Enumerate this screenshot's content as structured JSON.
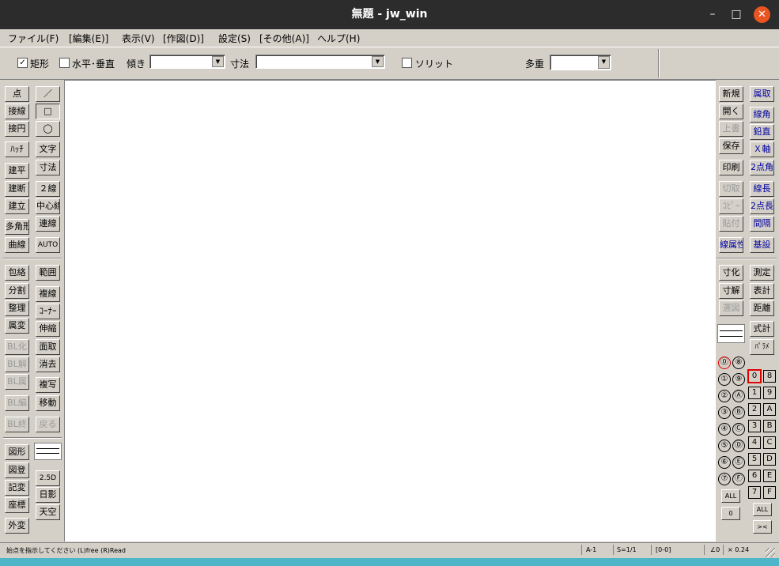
{
  "window": {
    "title": "無題 - jw_win",
    "controls": {
      "minimize": "–",
      "maximize": "□",
      "close": "✕"
    }
  },
  "menu": [
    {
      "label": "ファイル(F)"
    },
    {
      "label": "[編集(E)]"
    },
    {
      "label": "表示(V)"
    },
    {
      "label": "[作図(D)]"
    },
    {
      "label": "設定(S)"
    },
    {
      "label": "[その他(A)]"
    },
    {
      "label": "ヘルプ(H)"
    }
  ],
  "toolbar": {
    "rect_check": "✓",
    "rect_label": "矩形",
    "hv_label": "水平･垂直",
    "slope_label": "傾き",
    "slope_value": "",
    "dim_label": "寸法",
    "dim_value": "",
    "solid_label": "ソリット",
    "multi_label": "多重",
    "multi_value": ""
  },
  "left_tools": {
    "a": [
      "点",
      "接線",
      "接円",
      "ﾊｯﾁ",
      "建平",
      "建断",
      "建立",
      "多角形",
      "曲線"
    ],
    "b": [
      "／",
      "□",
      "◯",
      "文字",
      "寸法",
      "２線",
      "中心線",
      "連線",
      "AUTO"
    ],
    "c": [
      "包絡",
      "分割",
      "整理",
      "属変",
      "BL化",
      "BL解",
      "BL属",
      "BL編",
      "BL終"
    ],
    "d": [
      "範囲",
      "複線",
      "ｺｰﾅｰ",
      "伸縮",
      "面取",
      "消去",
      "複写",
      "移動",
      "戻る"
    ],
    "e": [
      "図形",
      "図登",
      "記変",
      "座標",
      "外変"
    ],
    "f": [
      "2.5D",
      "日影",
      "天空"
    ]
  },
  "right_tools": {
    "a": [
      "新規",
      "開く",
      "上書",
      "保存",
      "印刷",
      "切取",
      "ｺﾋﾟｰ",
      "貼付",
      "線属性"
    ],
    "b": [
      "属取",
      "線角",
      "鉛直",
      "Ｘ軸",
      "2点角",
      "線長",
      "2点長",
      "間隔",
      "基設"
    ],
    "c": [
      "寸化",
      "寸解",
      "選図"
    ],
    "d": [
      "測定",
      "表計",
      "距離",
      "式計",
      "ﾊﾟﾗﾒ"
    ]
  },
  "layer_groups": [
    "⓪",
    "①",
    "②",
    "③",
    "④",
    "⑤",
    "⑥",
    "⑦"
  ],
  "layer_groups2": [
    "⑧",
    "⑨",
    "Ⓐ",
    "Ⓑ",
    "Ⓒ",
    "Ⓓ",
    "Ⓔ",
    "Ⓕ"
  ],
  "layer_groups_all": "ALL",
  "layer_groups_zero": "0",
  "layers": [
    "0",
    "1",
    "2",
    "3",
    "4",
    "5",
    "6",
    "7"
  ],
  "layers2": [
    "8",
    "9",
    "A",
    "B",
    "C",
    "D",
    "E",
    "F"
  ],
  "layers_all": "ALL",
  "layers_swap": "><",
  "status": {
    "message": "始点を指示してください  (L)free  (R)Read",
    "layer": "A-1",
    "scale": "S=1/1",
    "group": "[0-0]",
    "angle": "∠0",
    "zoom": "× 0.24"
  }
}
